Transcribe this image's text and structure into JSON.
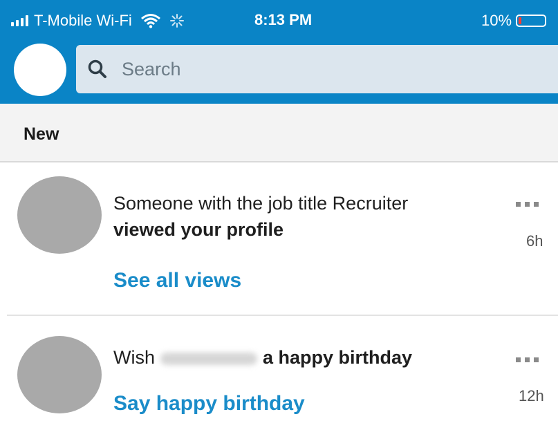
{
  "status_bar": {
    "carrier": "T-Mobile Wi-Fi",
    "time": "8:13 PM",
    "battery_pct": "10%",
    "battery_level": 0.1
  },
  "search": {
    "placeholder": "Search"
  },
  "section": {
    "title": "New"
  },
  "notifications": [
    {
      "line1": "Someone with the job title Recruiter",
      "line2_bold": "viewed your profile",
      "action": "See all views",
      "age": "6h"
    },
    {
      "prefix": "Wish",
      "suffix_bold": "a happy birthday",
      "action": "Say happy birthday",
      "age": "12h"
    }
  ],
  "colors": {
    "header": "#0a84c6",
    "link": "#1a8cc9",
    "avatar_placeholder": "#a9a9a9"
  },
  "icons": [
    "signal-icon",
    "wifi-icon",
    "activity-spinner-icon",
    "battery-icon",
    "search-icon",
    "more-icon"
  ]
}
